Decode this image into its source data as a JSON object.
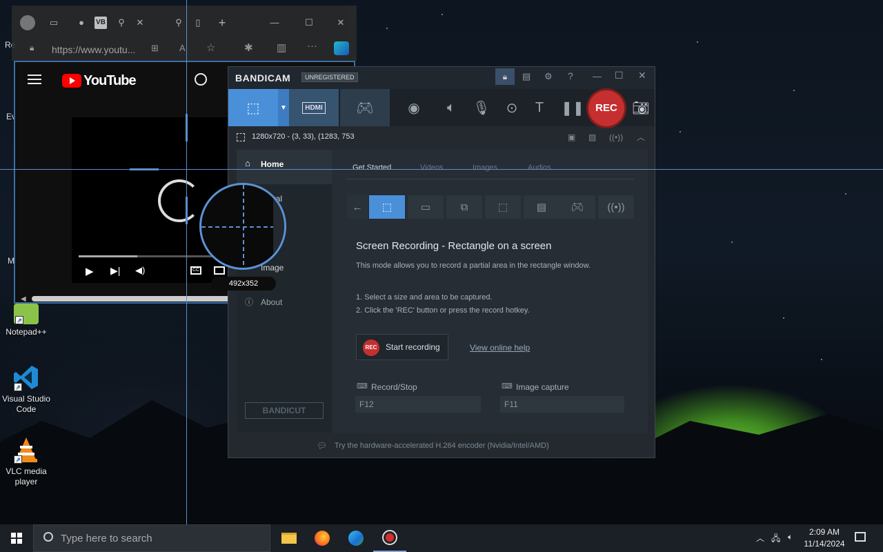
{
  "desktop": {
    "icons": [
      {
        "label": "Notepad++"
      },
      {
        "label": "Visual Studio Code"
      },
      {
        "label": "VLC media player"
      }
    ],
    "partial_labels": [
      "Re",
      "Ev",
      "M"
    ]
  },
  "browser": {
    "tab_badge": "VB",
    "url": "https://www.youtu...",
    "youtube": {
      "logo_text": "YouTube"
    }
  },
  "bandicam": {
    "brand": "BANDICAM",
    "badge": "UNREGISTERED",
    "mode_hdmi_label": "HDMI",
    "rec_label": "REC",
    "region_text": "1280x720 - (3, 33), (1283, 753",
    "sidebar": {
      "items": [
        {
          "label": "Home"
        },
        {
          "label": "eral"
        },
        {
          "label": "Image"
        },
        {
          "label": "About"
        }
      ],
      "bandicut_label": "BANDICUT"
    },
    "tabs": [
      "Get Started",
      "Videos",
      "Images",
      "Audios"
    ],
    "heading": "Screen Recording - Rectangle on a screen",
    "description": "This mode allows you to record a partial area in the rectangle window.",
    "steps": [
      "1. Select a size and area to be captured.",
      "2. Click the 'REC' button or press the record hotkey."
    ],
    "start_rec_badge": "REC",
    "start_recording": "Start recording",
    "help_link": "View online help",
    "record_stop_label": "Record/Stop",
    "record_stop_key": "F12",
    "image_capture_label": "Image capture",
    "image_capture_key": "F11",
    "footer": "Try the hardware-accelerated H.264 encoder (Nvidia/Intel/AMD)"
  },
  "overlay": {
    "size_label": "492x352"
  },
  "taskbar": {
    "search_placeholder": "Type here to search",
    "time": "2:09 AM",
    "date": "11/14/2024"
  },
  "colors": {
    "accent": "#4a90d9",
    "rec": "#c62f2f",
    "selection": "#5c8fd0"
  }
}
